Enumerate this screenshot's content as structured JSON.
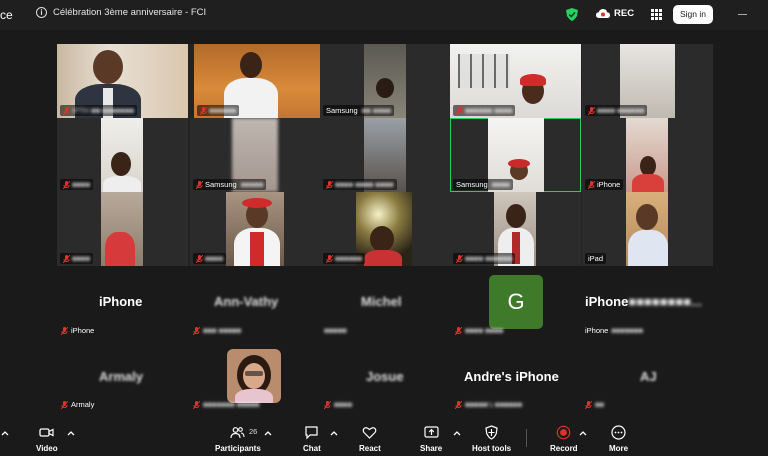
{
  "window": {
    "left_edge_text": "ce",
    "title": "Célébration 3ème anniversaire - FCI",
    "rec_label": "REC",
    "sign_in": "Sign in"
  },
  "gallery": [
    {
      "name": "",
      "muted": true,
      "blurred": true
    },
    {
      "name": "",
      "muted": true,
      "blurred": true
    },
    {
      "name": "Samsung",
      "muted": false,
      "blurred": false
    },
    {
      "name": "",
      "muted": true,
      "blurred": true
    },
    {
      "name": "",
      "muted": true,
      "blurred": true
    },
    {
      "name": "",
      "muted": true,
      "blurred": true
    },
    {
      "name": "Samsung",
      "muted": true,
      "blurred": false
    },
    {
      "name": "",
      "muted": true,
      "blurred": true
    },
    {
      "name": "Samsung",
      "muted": false,
      "blurred": false,
      "active": true
    },
    {
      "name": "iPhone",
      "muted": true,
      "blurred": false
    },
    {
      "name": "",
      "muted": true,
      "blurred": true
    },
    {
      "name": "",
      "muted": true,
      "blurred": true
    },
    {
      "name": "",
      "muted": true,
      "blurred": true
    },
    {
      "name": "",
      "muted": true,
      "blurred": true
    },
    {
      "name": "iPad",
      "muted": false,
      "blurred": false
    }
  ],
  "participants_row1": [
    {
      "big": "iPhone",
      "small": "iPhone",
      "muted": true
    },
    {
      "big": "Ann-Vathy",
      "small": "",
      "muted": true
    },
    {
      "big": "Michel",
      "small": "",
      "muted": false
    },
    {
      "big": "",
      "small": "",
      "muted": true,
      "avatar_letter": "G"
    },
    {
      "big": "iPhone",
      "small": "iPhone",
      "muted": false
    }
  ],
  "participants_row2": [
    {
      "big": "Armaly",
      "small": "Armaly",
      "muted": true
    },
    {
      "big": "",
      "small": "",
      "muted": true
    },
    {
      "big": "Josue",
      "small": "",
      "muted": false
    },
    {
      "big": "Andre's iPhone",
      "small": "",
      "muted": true
    },
    {
      "big": "AJ",
      "small": "",
      "muted": true
    }
  ],
  "toolbar": {
    "video": "Video",
    "participants": "Participants",
    "participants_count": "26",
    "chat": "Chat",
    "react": "React",
    "share": "Share",
    "host_tools": "Host tools",
    "record": "Record",
    "more": "More"
  },
  "colors": {
    "accent_green": "#23d160",
    "mute_red": "#e0322b",
    "avatar_green": "#3e7a2a",
    "background": "#1a1a1a"
  }
}
